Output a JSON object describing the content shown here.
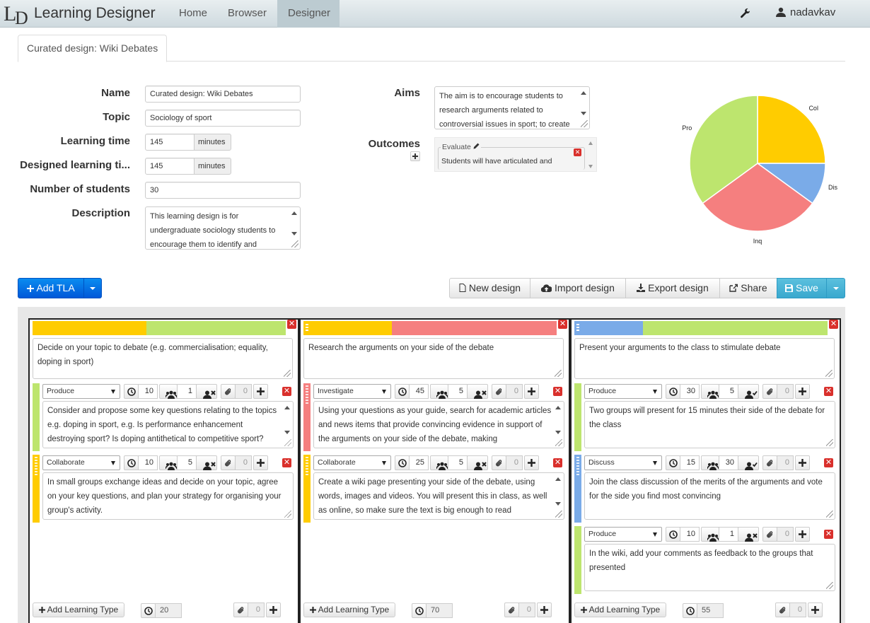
{
  "app": {
    "title": "Learning Designer",
    "logo_text": "LD",
    "user": "nadavkav"
  },
  "nav": [
    {
      "label": "Home"
    },
    {
      "label": "Browser"
    },
    {
      "label": "Designer"
    }
  ],
  "tab": "Curated design: Wiki Debates",
  "form": {
    "name_label": "Name",
    "name": "Curated design: Wiki Debates",
    "topic_label": "Topic",
    "topic": "Sociology of sport",
    "lt_label": "Learning time",
    "lt": "145",
    "dlt_label": "Designed learning ti...",
    "dlt": "145",
    "minutes": "minutes",
    "students_label": "Number of students",
    "students": "30",
    "desc_label": "Description",
    "desc": "This learning design is for undergraduate sociology students to encourage them to identify and",
    "aims_label": "Aims",
    "aims": "The aim is to encourage students to research arguments related to controversial issues in sport; to create",
    "outcomes_label": "Outcomes",
    "outcome_type": "Evaluate",
    "outcome_text": "Students will have articulated and"
  },
  "chart_data": {
    "type": "pie",
    "slices": [
      {
        "label": "Col",
        "value": 25,
        "color": "#ffcc00"
      },
      {
        "label": "Dis",
        "value": 10,
        "color": "#7aabe8"
      },
      {
        "label": "Inq",
        "value": 30,
        "color": "#f57f7f"
      },
      {
        "label": "Pro",
        "value": 35,
        "color": "#bde56e"
      }
    ]
  },
  "toolbar": {
    "add_tla": "Add TLA",
    "new": "New design",
    "import": "Import design",
    "export": "Export design",
    "share": "Share",
    "save": "Save"
  },
  "tlas": [
    {
      "title": "Decide on your topic to debate (e.g. commercialisation; equality, doping in sport)",
      "bar": [
        {
          "c": "#ffcc00",
          "w": 45
        },
        {
          "c": "#bde56e",
          "w": 55
        }
      ],
      "total": "20",
      "items": [
        {
          "type": "Produce",
          "color": "#bde56e",
          "time": "10",
          "group": "1",
          "res": "0",
          "text": "Consider and propose some key questions relating to the topics e.g. doping in sport, e.g. Is performance enhancement destroying sport? Is doping antithetical to competitive sport?",
          "tall": true
        },
        {
          "type": "Collaborate",
          "color": "#ffcc00",
          "time": "10",
          "group": "5",
          "res": "0",
          "text": "In small groups exchange ideas and decide on your topic, agree on your key questions, and plan your strategy for organising your group's activity.",
          "tall": false
        }
      ]
    },
    {
      "title": "Research the arguments on your side of the debate",
      "bar": [
        {
          "c": "#ffcc00",
          "w": 35
        },
        {
          "c": "#f57f7f",
          "w": 65
        }
      ],
      "total": "70",
      "items": [
        {
          "type": "Investigate",
          "color": "#f57f7f",
          "time": "45",
          "group": "5",
          "res": "0",
          "text": "Using your questions as your guide, search for academic articles and news items that provide convincing evidence in support of the arguments on your side of the debate, making",
          "tall": true
        },
        {
          "type": "Collaborate",
          "color": "#ffcc00",
          "time": "25",
          "group": "5",
          "res": "0",
          "text": "Create a wiki page presenting your side of the debate, using words, images and videos. You will present this in class, as well as online, so make sure the text is big enough to read",
          "tall": true
        }
      ]
    },
    {
      "title": "Present your arguments to the class to stimulate debate",
      "bar": [
        {
          "c": "#7aabe8",
          "w": 27
        },
        {
          "c": "#bde56e",
          "w": 73
        }
      ],
      "total": "55",
      "items": [
        {
          "type": "Produce",
          "color": "#bde56e",
          "time": "30",
          "group": "5",
          "res": "0",
          "text": "Two groups will present for 15 minutes their side of the debate for the class",
          "tall": false
        },
        {
          "type": "Discuss",
          "color": "#7aabe8",
          "time": "15",
          "group": "30",
          "res": "0",
          "text": "Join the class discussion of the merits of the arguments and vote for the side you find most convincing",
          "tall": false
        },
        {
          "type": "Produce",
          "color": "#bde56e",
          "time": "10",
          "group": "1",
          "res": "0",
          "text": "In the wiki, add your comments as feedback to the groups that presented",
          "tall": false
        }
      ]
    }
  ],
  "add_lt": "Add Learning Type"
}
